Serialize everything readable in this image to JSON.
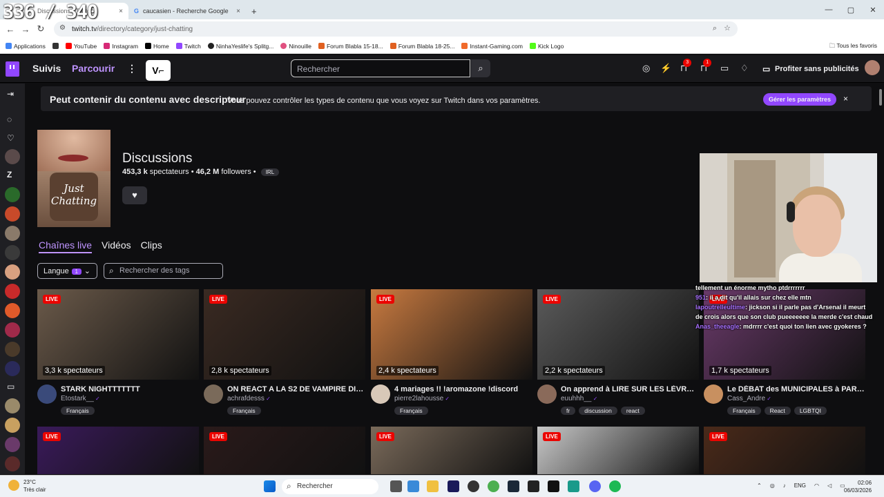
{
  "browser": {
    "tabs": [
      {
        "title": "Discussions - Twitch",
        "close": "×"
      },
      {
        "title": "caucasien - Recherche Google",
        "close": "×"
      }
    ],
    "new_tab": "+",
    "overlay": "336 / 340",
    "url_host": "twitch.tv",
    "url_path": "/directory/category/just-chatting",
    "win": [
      "—",
      "▢",
      "✕"
    ]
  },
  "bookmarks": {
    "items": [
      "Applications",
      "YouTube",
      "Instagram",
      "Home",
      "Twitch",
      "NinhaYeslife's Splitg...",
      "Ninouille",
      "Forum Blabla 15-18...",
      "Forum Blabla 18-25...",
      "Instant-Gaming.com",
      "Kick Logo"
    ],
    "right": "Tous les favoris"
  },
  "twitch": {
    "nav": {
      "following": "Suivis",
      "browse": "Parcourir",
      "more": "⋮"
    },
    "search_placeholder": "Rechercher",
    "badges": {
      "inbox": "3",
      "messages": "1"
    },
    "turbo": "Profiter sans publicités"
  },
  "banner": {
    "title": "Peut contenir du contenu avec descripteur",
    "text": "Vous pouvez contrôler les types de contenu que vous voyez sur Twitch dans vos paramètres.",
    "button": "Gérer les paramètres",
    "close": "×"
  },
  "category": {
    "boxart_text": "Just Chatting",
    "title": "Discussions",
    "viewers": "453,3 k",
    "viewers_label": "spectateurs",
    "followers": "46,2 M",
    "followers_label": "followers",
    "tag": "IRL"
  },
  "tabs": [
    "Chaînes live",
    "Vidéos",
    "Clips"
  ],
  "filters": {
    "lang_label": "Langue",
    "lang_count": "1",
    "tags_placeholder": "Rechercher des tags"
  },
  "live_label": "LIVE",
  "streams": [
    {
      "viewers": "3,3 k spectateurs",
      "title": "STARK NIGHTTTTTTT",
      "channel": "Etostark__",
      "tags": [
        "Français"
      ],
      "color": "#6b5a4a",
      "avatar": "#3a4a7a"
    },
    {
      "viewers": "2,8 k spectateurs",
      "title": "ON REACT A LA S2 DE VAMPIRE DIARI...",
      "channel": "achrafdesss",
      "tags": [
        "Français"
      ],
      "color": "#3a2a22",
      "avatar": "#7a6a5a"
    },
    {
      "viewers": "2,4 k spectateurs",
      "title": "4 mariages !! !aromazone !discord",
      "channel": "pierre2lahousse",
      "tags": [
        "Français"
      ],
      "color": "#c87a40",
      "avatar": "#d8c8b8"
    },
    {
      "viewers": "2,2 k spectateurs",
      "title": "On apprend à LIRE SUR LES LÈVRES ...",
      "channel": "euuhhh__",
      "tags": [
        "fr",
        "discussion",
        "react"
      ],
      "color": "#5a5a5a",
      "avatar": "#8a6a5a"
    },
    {
      "viewers": "1,7 k spectateurs",
      "title": "Le DÉBAT des MUNICIPALES à PARIS ! ...",
      "channel": "Cass_Andre",
      "tags": [
        "Français",
        "React",
        "LGBTQI"
      ],
      "color": "#6a3a6a",
      "avatar": "#c89060"
    }
  ],
  "bottom_streams": [
    {
      "color": "#3a1a5a"
    },
    {
      "color": "#2a1a1a"
    },
    {
      "color": "#7a6a5a"
    },
    {
      "color": "#c8c8c8"
    },
    {
      "color": "#4a2a1a"
    }
  ],
  "chat": [
    {
      "user": "",
      "msg": "tellement un énorme mytho ptdrrrrrrr"
    },
    {
      "user": "951",
      "msg": ": il a dit qu'il allais sur chez elle mtn"
    },
    {
      "user": "lapoutrelleultime",
      "msg": ": jickson si il parle pas d'Arsenal il meurt"
    },
    {
      "user": "",
      "msg": "de crois alors que son club pueeeeeee la merde c'est chaud"
    },
    {
      "user": "Anas_theeagle",
      "msg": ": mdrrrr c'est quoi ton lien avec gyokeres ?"
    }
  ],
  "taskbar": {
    "temp": "23°C",
    "weather": "Très clair",
    "search": "Rechercher",
    "lang": "ENG",
    "time": "02:06",
    "date": "06/03/2026"
  }
}
